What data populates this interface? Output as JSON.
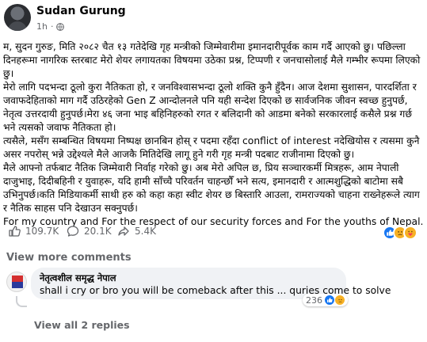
{
  "post": {
    "author": "Sudan Gurung",
    "time": "1h",
    "paragraphs": [
      "म, सुदन गुरुङ, मिति २०८२ चैत १३ गतेदेखि गृह मन्त्रीको जिम्मेवारीमा इमानदारीपूर्वक काम गर्दै आएको छु। पछिल्ला दिनहरूमा नागरिक स्तरबाट मेरो शेयर लगायतका विषयमा उठेका प्रश्न, टिप्पणी र जनचासोलाई मैले गम्भीर रूपमा लिएको छु।",
      "मेरो लागि पदभन्दा ठूलो कुरा नैतिकता हो, र जनविश्वासभन्दा ठूलो शक्ति कुनै हुँदैन। आज देशमा सुशासन, पारदर्शिता र जवाफदेहिताको माग गर्दै उठिरहेको Gen Z आन्दोलनले पनि यही सन्देश दिएको छ सार्वजनिक जीवन स्वच्छ हुनुपर्छ, नेतृत्व उत्तरदायी हुनुपर्छ।मेरा ४६ जना भाइ बहिनिहरुको रगत र बलिदानी को आडमा बनेको सरकारलाई कसैले प्रश्न गर्छ भने त्यसको जवाफ नैतिकता हो।",
      "त्यसैले, मसँग सम्बन्धित विषयमा निष्पक्ष छानबिन होस् र पदमा रहँदा conflict of interest नदेखियोस र त्यसमा कुनै असर नपरोस् भन्ने उद्देश्यले मैले आजकै मितिदेखि लागू हुने गरी गृह मन्त्री पदबाट राजीनामा दिएको छु।",
      "मैले आफ्नो तर्फबाट नैतिक जिम्मेवारी निर्वाह गरेको छु। अब मेरो अपिल छ, प्रिय सञ्चारकर्मी मित्रहरू, आम नेपाली दाजुभाइ, दिदीबहिनी र युवाहरू, यदि हामी साँच्चै परिवर्तन चाहन्छौँ भने सत्य, इमानदारी र आत्मशुद्धिको बाटोमा सबै उभिनुपर्छ।कति मिडियाकर्मी साथी हरु को कहा कहा स्वीट शेयर छ बिस्तारि आउला, रामराज्यको चाहना राख्नेहरूले त्याग र नैतिक साहस पनि देखाउन सक्नुपर्छ।",
      "For my country and For the respect of our security forces and For the youths of Nepal."
    ]
  },
  "stats": {
    "likes": "109.7K",
    "comments": "20.1K",
    "shares": "5.4K"
  },
  "view_more_comments": "View more comments",
  "comment": {
    "author": "नेतृत्वशील समृद्ध नेपाल",
    "text": "shall i cry or bro you will be comeback after this ... quries come to solve",
    "reaction_count": "236"
  },
  "view_replies": "View all 2 replies",
  "colors": {
    "like_blue": "#1877f2",
    "muted": "#65676b",
    "bubble_bg": "#f0f2f5"
  },
  "icons": [
    "globe-icon",
    "like-icon",
    "comment-icon",
    "share-icon",
    "like-reaction-icon",
    "sad-reaction-icon",
    "care-reaction-icon"
  ]
}
